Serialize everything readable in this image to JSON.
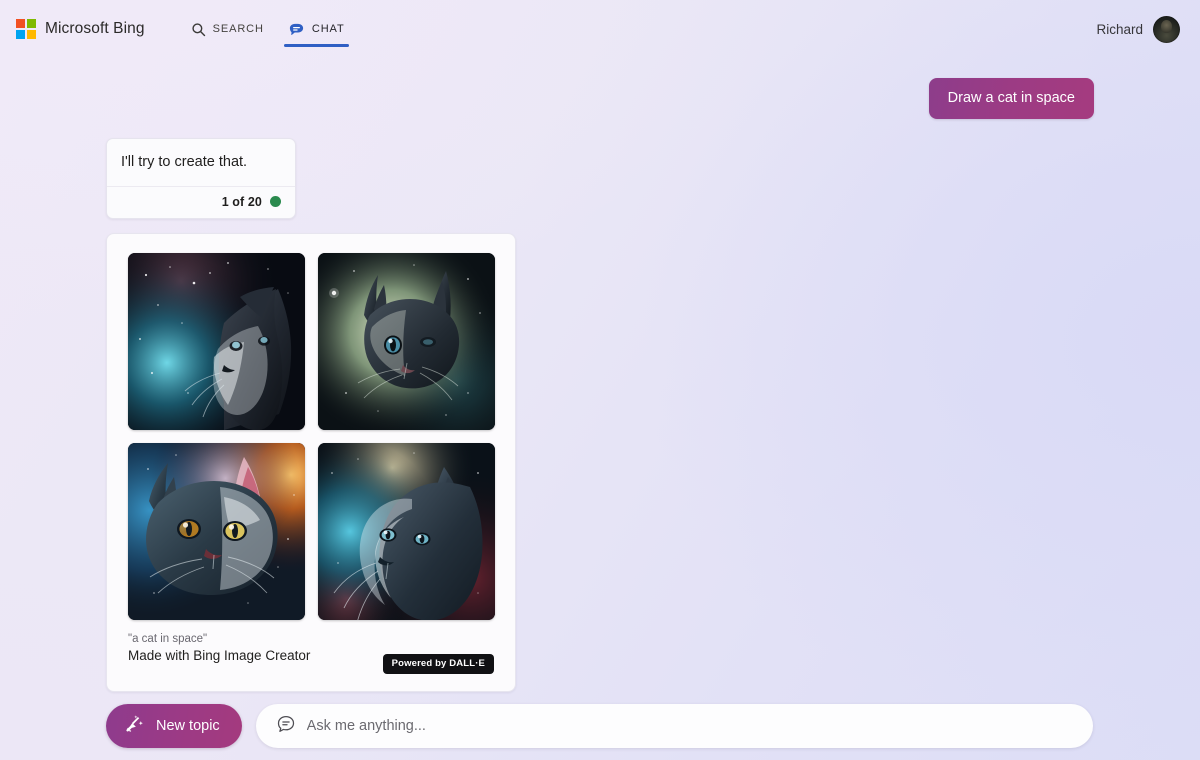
{
  "header": {
    "logo_icon": "microsoft-squares-icon",
    "brand": "Microsoft Bing",
    "tabs": [
      {
        "label": "SEARCH",
        "icon": "search-icon",
        "active": false
      },
      {
        "label": "CHAT",
        "icon": "chat-bubble-icon",
        "active": true
      }
    ],
    "user_name": "Richard",
    "avatar_icon": "user-avatar"
  },
  "conversation": {
    "user_message": "Draw a cat in space",
    "assistant_message": "I'll try to create that.",
    "turn_counter": "1 of 20",
    "turn_status_icon": "green-status-dot"
  },
  "image_card": {
    "prompt_quote": "\"a cat in space\"",
    "made_with": "Made with Bing Image Creator",
    "badge": "Powered by DALL·E",
    "images": [
      {
        "alt": "dark cat profile facing right over teal nebula",
        "palette": [
          "#0b1220",
          "#2f7f93",
          "#d8e4ea",
          "#1a2430"
        ]
      },
      {
        "alt": "cat face with pale green cream nebula glow",
        "palette": [
          "#0d1418",
          "#b9c79a",
          "#e8ecd8",
          "#243034"
        ]
      },
      {
        "alt": "fluffy cat with amber eyes blue and orange nebula",
        "palette": [
          "#132233",
          "#c9651f",
          "#dce6ef",
          "#e0a84f"
        ]
      },
      {
        "alt": "cat three quarter profile facing left teal and maroon nebula",
        "palette": [
          "#0c1a22",
          "#2e8ca0",
          "#e6dfc8",
          "#3a1620"
        ]
      }
    ]
  },
  "bottom": {
    "new_topic_label": "New topic",
    "new_topic_icon": "broom-sparkle-icon",
    "composer_icon": "chat-bubble-lines-icon",
    "composer_placeholder": "Ask me anything...",
    "composer_value": ""
  },
  "colors": {
    "accent_magenta": "#9c3a85",
    "accent_blue": "#2f5fc4",
    "status_green": "#2a8a4e",
    "badge_black": "#111114"
  }
}
